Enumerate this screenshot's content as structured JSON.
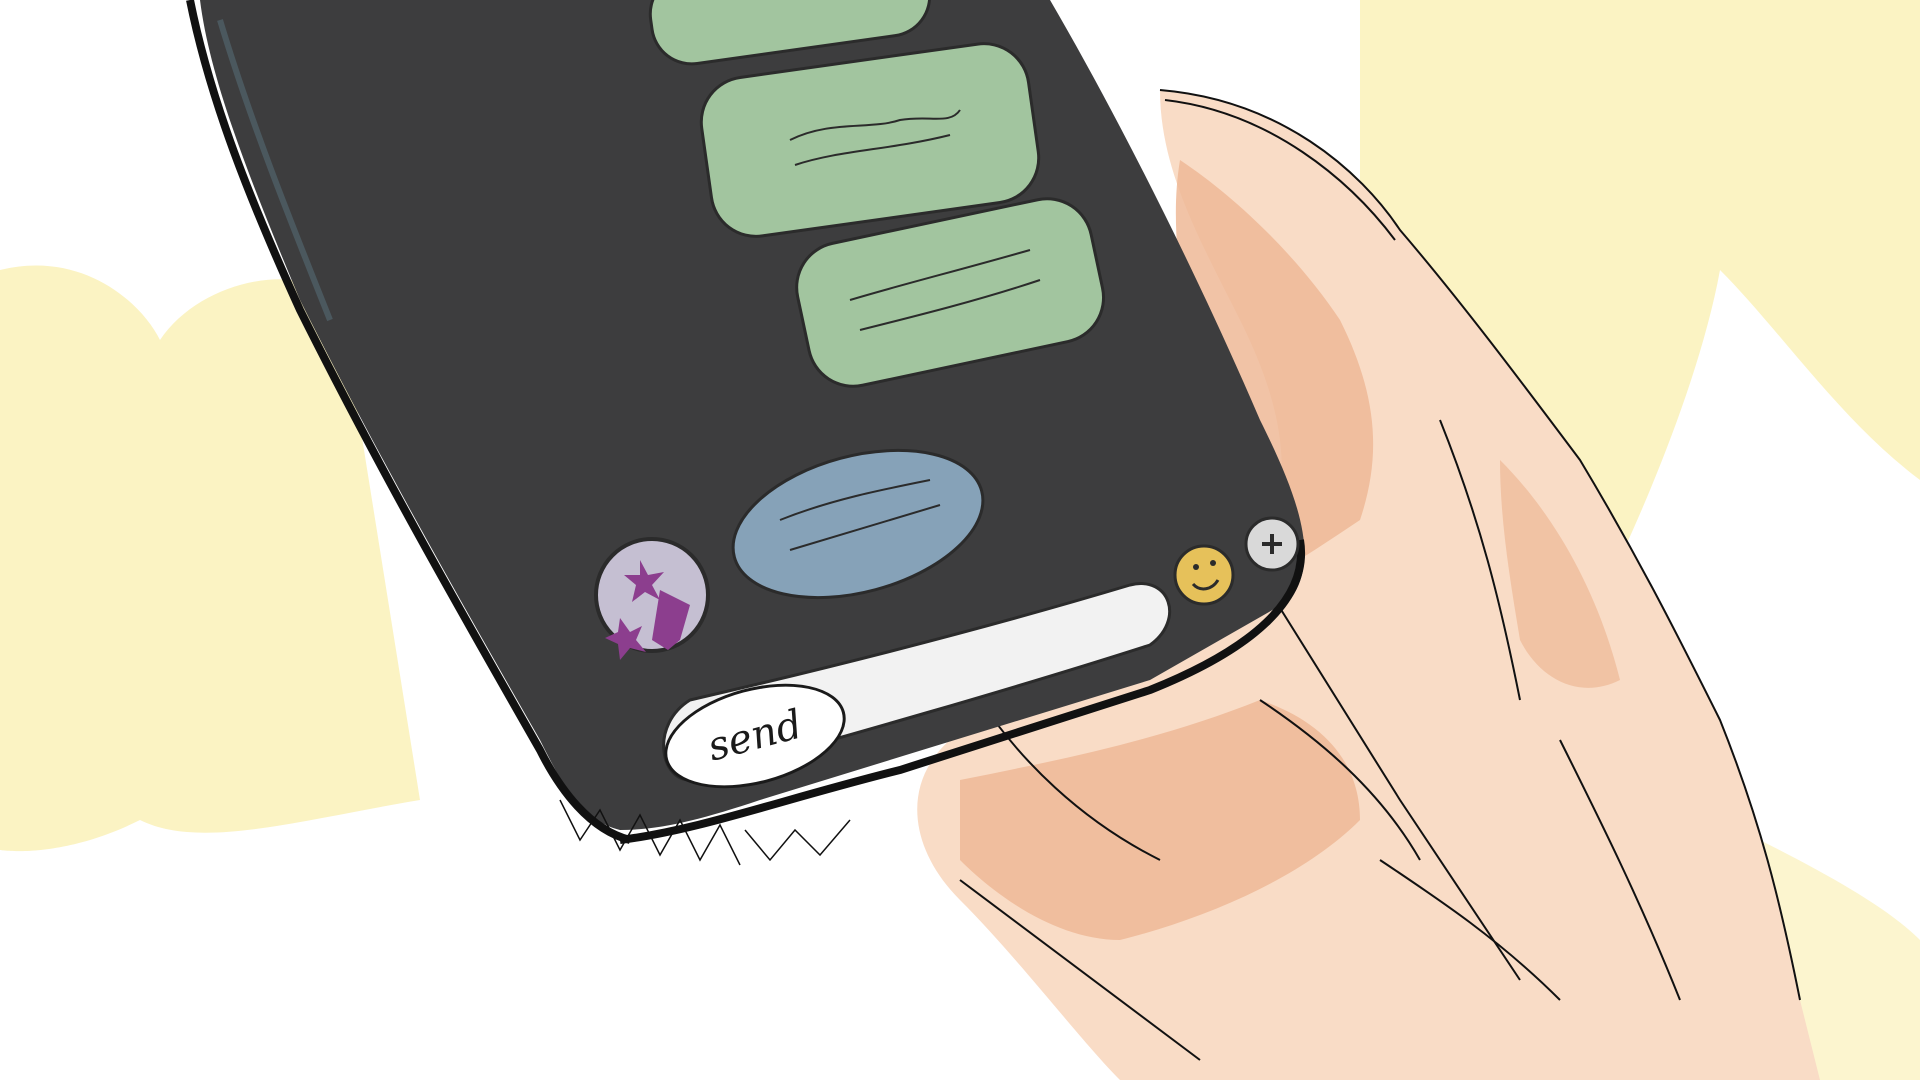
{
  "composer": {
    "send_label": "send"
  },
  "icons": {
    "emoji": "smiley-face-icon",
    "add": "plus-icon",
    "avatar": "avatar-icon"
  },
  "colors": {
    "background_blob": "#fbf3c3",
    "phone_body": "#3d3d3e",
    "outgoing_bubble": "#a2c59f",
    "incoming_bubble": "#86a2b8",
    "input_bar": "#f2f2f2",
    "emoji_button": "#e6c15a",
    "hand_skin": "#f7d6bd",
    "hand_shadow": "#eeb896",
    "avatar": "#c5bfd2",
    "avatar_stars": "#8c3e8e"
  }
}
